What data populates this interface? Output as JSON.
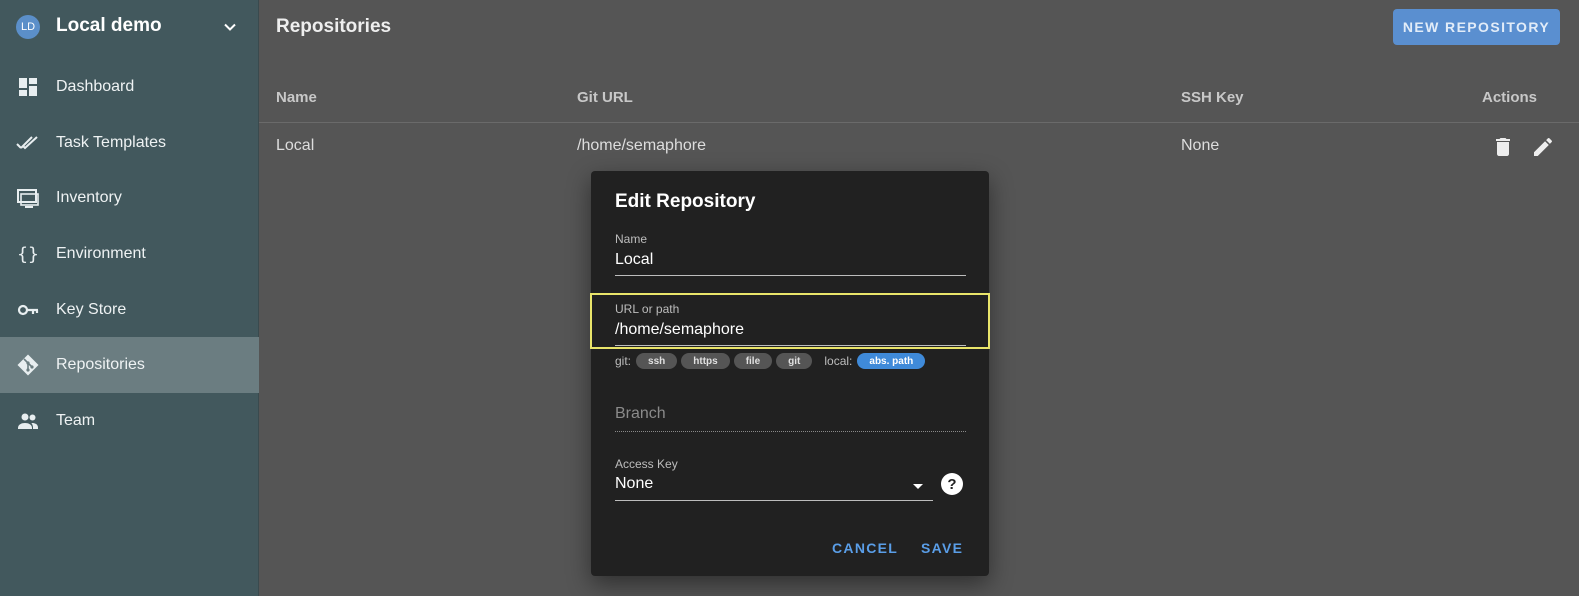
{
  "sidebar": {
    "project": {
      "initials": "LD",
      "name": "Local demo"
    },
    "items": [
      {
        "label": "Dashboard",
        "icon": "dashboard-icon"
      },
      {
        "label": "Task Templates",
        "icon": "double-check-icon"
      },
      {
        "label": "Inventory",
        "icon": "monitor-icon"
      },
      {
        "label": "Environment",
        "icon": "braces-icon"
      },
      {
        "label": "Key Store",
        "icon": "key-icon"
      },
      {
        "label": "Repositories",
        "icon": "git-icon",
        "active": true
      },
      {
        "label": "Team",
        "icon": "people-icon"
      }
    ]
  },
  "main": {
    "title": "Repositories",
    "new_button": "NEW REPOSITORY",
    "table": {
      "columns": [
        "Name",
        "Git URL",
        "SSH Key",
        "Actions"
      ],
      "rows": [
        {
          "name": "Local",
          "git_url": "/home/semaphore",
          "ssh_key": "None"
        }
      ]
    }
  },
  "dialog": {
    "title": "Edit Repository",
    "name_label": "Name",
    "name_value": "Local",
    "url_label": "URL or path",
    "url_value": "/home/semaphore",
    "git_label": "git:",
    "git_chips": [
      "ssh",
      "https",
      "file",
      "git"
    ],
    "local_label": "local:",
    "local_chip": "abs. path",
    "branch_placeholder": "Branch",
    "access_key_label": "Access Key",
    "access_key_value": "None",
    "help_glyph": "?",
    "cancel": "CANCEL",
    "save": "SAVE"
  },
  "colors": {
    "sidebar_bg": "#42585d",
    "active_item_bg": "#6b7d81",
    "accent": "#5a8fd0",
    "highlight_border": "#e9e46a",
    "chip_selected": "#3f8ad9"
  }
}
